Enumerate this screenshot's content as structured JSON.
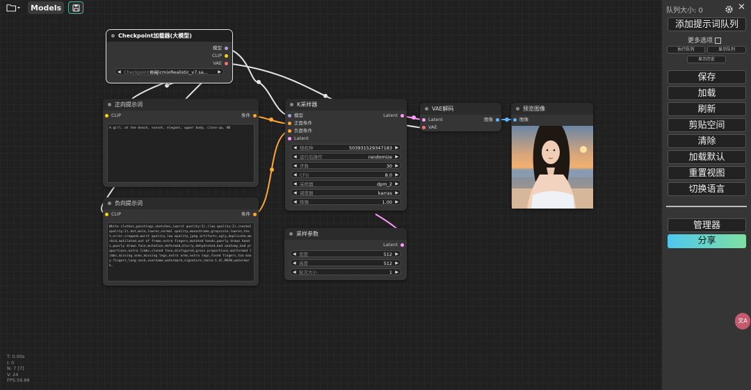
{
  "topbar": {
    "models_label": "Models",
    "folder_icon": "folder-icon",
    "save_icon": "floppy-disk-icon"
  },
  "nodes": {
    "checkpoint": {
      "title": "Checkpoint加载器(大模型)",
      "outputs": [
        "模型",
        "CLIP",
        "VAE"
      ],
      "widget_label": "Checkpoint名称",
      "widget_value": "majicmixRealistic_v7.sa..."
    },
    "positive": {
      "title": "正向提示词",
      "input": "CLIP",
      "output": "条件",
      "text": "A girl, at the beach, sunset, elegant, upper body, close-up, HD"
    },
    "negative": {
      "title": "负向提示词",
      "input": "CLIP",
      "output": "条件",
      "text": "White clothes,paintings,sketches,(worst quality:2),(low quality:2),(normal quality:2),dot,mole,lowres,normal quality,monochrome,grayscale,lowres,text,error,cropped,worst quality,low quality,jpeg artifacts,ugly,duplicate,morbid,mutilated,out of frame,extra fingers,mutated hands,poorly drawn hands,poorly drawn face,mutation,deformed,blurry,dehydrated,bad anatomy,bad proportions,extra limbs,cloned face,disfigured,gross proportions,malformed limbs,missing arms,missing legs,extra arms,extra legs,fused fingers,too many fingers,long neck,username,watermark,signature,(mole:1.4),NSFW,watermark,"
    },
    "ksampler": {
      "title": "K采样器",
      "inputs": [
        "模型",
        "正面条件",
        "负面条件",
        "Latent"
      ],
      "output": "Latent",
      "widgets": [
        {
          "label": "随机种",
          "value": "503931529347183"
        },
        {
          "label": "运行后操作",
          "value": "randomize"
        },
        {
          "label": "步数",
          "value": "30"
        },
        {
          "label": "CFG",
          "value": "8.0"
        },
        {
          "label": "采样器",
          "value": "dpm_2"
        },
        {
          "label": "调度器",
          "value": "karras"
        },
        {
          "label": "降噪",
          "value": "1.00"
        }
      ]
    },
    "vae_decode": {
      "title": "VAE解码",
      "inputs": [
        "Latent",
        "VAE"
      ],
      "output": "图像"
    },
    "preview": {
      "title": "预览图像",
      "input": "图像"
    },
    "latent": {
      "title": "采样参数",
      "output": "Latent",
      "widgets": [
        {
          "label": "宽度",
          "value": "512"
        },
        {
          "label": "高度",
          "value": "512"
        },
        {
          "label": "批次大小",
          "value": "1"
        }
      ]
    }
  },
  "stats": {
    "t": "T: 0.00s",
    "i": "I: 0",
    "n": "N: 7 [7]",
    "v": "V: 24",
    "fps": "FPS:59.88"
  },
  "panel": {
    "queue_size": "队列大小: 0",
    "add_queue": "添加提示词队列",
    "more_options": "更多选项",
    "run_queue": "执行队列",
    "show_queue": "显示队列",
    "show_history": "显示历史",
    "buttons": [
      "保存",
      "加载",
      "刷新",
      "剪贴空间",
      "清除",
      "加载默认",
      "重置视图",
      "切换语言"
    ],
    "manager": "管理器",
    "share": "分享",
    "gear_icon": "gear-icon",
    "close_icon": "close-icon"
  },
  "colors": {
    "clip": "#ffd500",
    "model": "#b39ddb",
    "vae": "#ff6e6e",
    "latent": "#ff9cf9",
    "conditioning": "#ffa931",
    "image": "#64b5f6"
  }
}
